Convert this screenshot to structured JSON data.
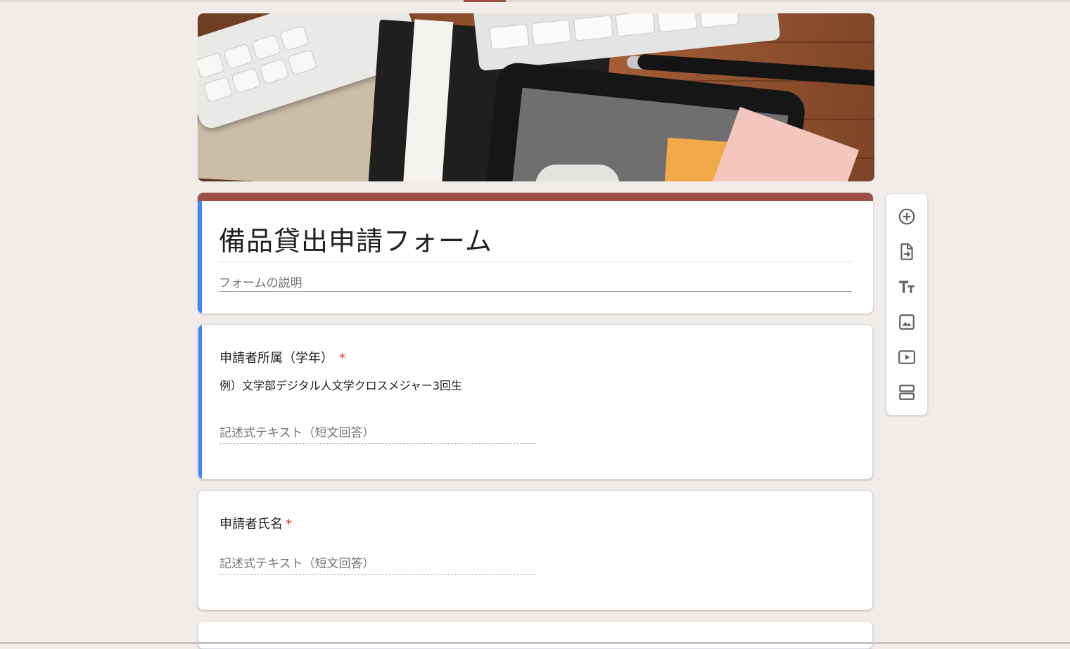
{
  "form": {
    "title": "備品貸出申請フォーム",
    "description_placeholder": "フォームの説明"
  },
  "questions": [
    {
      "title": "申請者所属（学年）",
      "required_mark": "*",
      "help_text": "例）文学部デジタル人文学クロスメジャー3回生",
      "answer_placeholder": "記述式テキスト（短文回答）"
    },
    {
      "title": "申請者氏名",
      "required_mark": "*",
      "answer_placeholder": "記述式テキスト（短文回答）"
    }
  ],
  "toolbar": {
    "icons": [
      "add-question-icon",
      "import-questions-icon",
      "add-title-icon",
      "add-image-icon",
      "add-video-icon",
      "add-section-icon"
    ]
  },
  "colors": {
    "theme_accent": "#9c4f48",
    "active_card_accent": "#4285f4",
    "required": "#d93025",
    "background": "#f1ece9"
  }
}
